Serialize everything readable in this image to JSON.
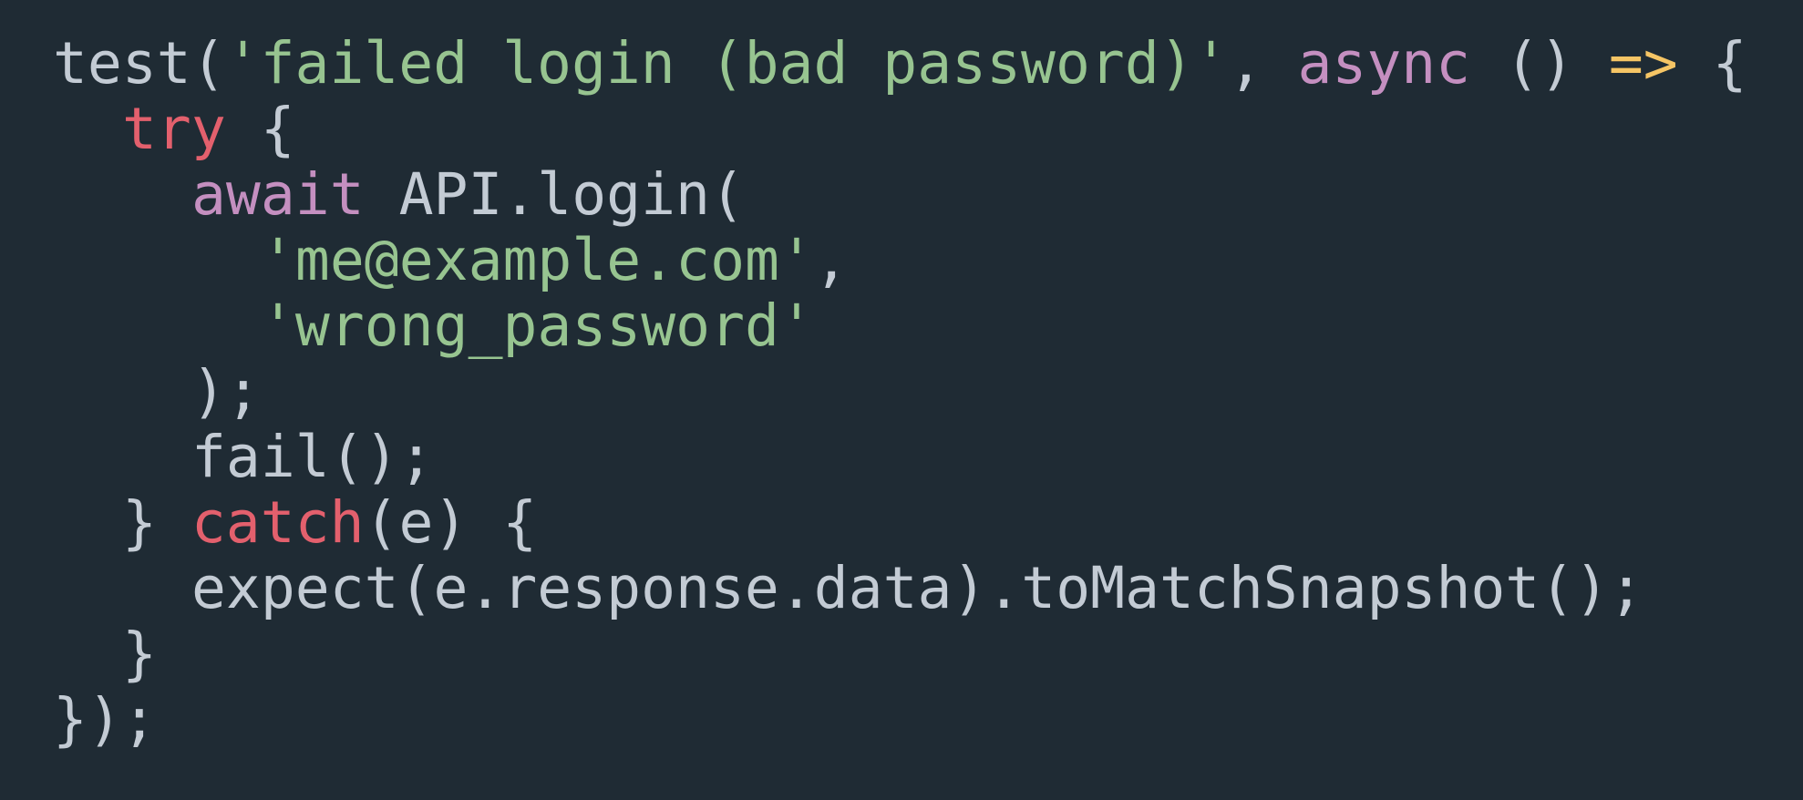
{
  "code": {
    "l1": {
      "fn": "test(",
      "str": "'failed login (bad password)'",
      "comma": ", ",
      "async": "async",
      "parens": " () ",
      "arrow": "=>",
      "brace": " {"
    },
    "l2": {
      "try": "try",
      "brace": " {"
    },
    "l3": {
      "await": "await",
      "call": " API.login("
    },
    "l4": {
      "str": "'me@example.com'",
      "comma": ","
    },
    "l5": {
      "str": "'wrong_password'"
    },
    "l6": {
      "text": ");"
    },
    "l7": {
      "text": "fail();"
    },
    "l8": {
      "close": "} ",
      "catch": "catch",
      "rest": "(e) {"
    },
    "l9": {
      "text": "expect(e.response.data).toMatchSnapshot();"
    },
    "l10": {
      "text": "}"
    },
    "l11": {
      "text": "});"
    }
  },
  "colors": {
    "background": "#1f2b34",
    "plain": "#c3cbd4",
    "keyword_flow": "#e3606d",
    "keyword": "#c48fc0",
    "string": "#97c490",
    "arrow": "#f5c565"
  }
}
